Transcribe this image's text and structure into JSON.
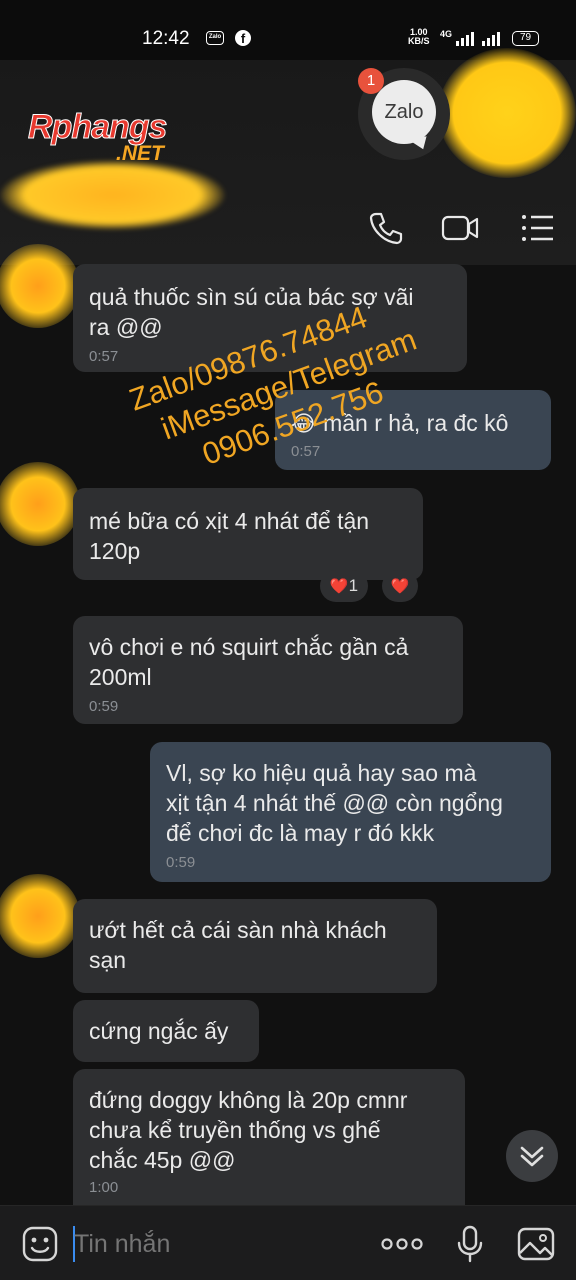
{
  "status_bar": {
    "time": "12:42",
    "zalo_label": "Zalo",
    "fb_label": "f",
    "net_speed": "1.00",
    "net_unit": "KB/S",
    "network": "4G",
    "battery": "79"
  },
  "header": {
    "logo_main": "Rphangs",
    "logo_sub": ".NET",
    "zalo_bubble_label": "Zalo",
    "zalo_badge_count": "1",
    "icons": [
      "phone-icon",
      "video-call-icon",
      "menu-icon"
    ]
  },
  "watermark": {
    "line1": "Zalo/09876.74844",
    "line2": "iMessage/Telegram",
    "line3": "0906.552.756"
  },
  "messages": [
    {
      "direction": "in",
      "text": "quả thuốc sìn sú của bác sợ vãi\nra @@",
      "time": "0:57"
    },
    {
      "direction": "out",
      "text": "mần r hả, ra đc kô",
      "emoji": "😂",
      "time": "0:57"
    },
    {
      "direction": "in",
      "text": "mé bữa có xịt 4 nhát để tận\n120p",
      "time": ""
    },
    {
      "direction": "in",
      "text": "vô chơi e nó squirt chắc gần cả\n200ml",
      "time": "0:59"
    },
    {
      "direction": "out",
      "text": "Vl, sợ ko hiệu quả hay sao mà\nxịt tận 4 nhát thế @@ còn ngổng\nđể chơi đc là may r đó kkk",
      "time": "0:59"
    },
    {
      "direction": "in",
      "text": "ướt hết cả cái sàn nhà khách\nsạn",
      "time": ""
    },
    {
      "direction": "in",
      "text": "cứng ngắc ấy",
      "time": ""
    },
    {
      "direction": "in",
      "text": "đứng doggy không là 20p cmnr\nchưa kể truyền thống vs ghế\nchắc 45p @@",
      "time": "1:00"
    }
  ],
  "reactions": {
    "heart_count": "1",
    "heart_emoji": "❤️"
  },
  "input": {
    "placeholder": "Tin nhắn",
    "icons": [
      "emoji-icon",
      "more-icon",
      "microphone-icon",
      "image-icon"
    ]
  },
  "colors": {
    "background": "#111111",
    "incoming_bubble": "#2e2f31",
    "outgoing_bubble": "#3a4552",
    "watermark": "#f0a623",
    "accent": "#3a8cf0"
  }
}
